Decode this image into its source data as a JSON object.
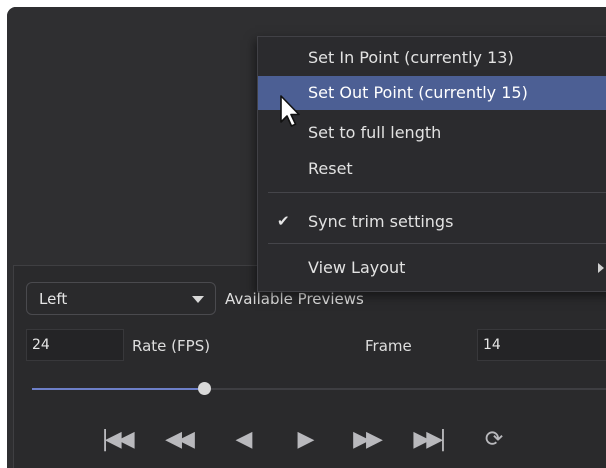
{
  "preview_panel": {
    "view_select": {
      "value": "Left"
    },
    "available_previews_label": "Available Previews",
    "fps_field": {
      "value": "24"
    },
    "rate_label": "Rate (FPS)",
    "frame_label": "Frame",
    "frame_field": {
      "value": "14"
    },
    "scrubber": {
      "position_fraction": 0.3
    },
    "transport_buttons": [
      {
        "icon": "skip-to-start-icon",
        "glyph": "|◀◀"
      },
      {
        "icon": "step-back-icon",
        "glyph": "◀◀"
      },
      {
        "icon": "play-reverse-icon",
        "glyph": "◀"
      },
      {
        "icon": "play-icon",
        "glyph": "▶"
      },
      {
        "icon": "fast-forward-icon",
        "glyph": "▶▶"
      },
      {
        "icon": "skip-to-end-icon",
        "glyph": "▶▶|"
      },
      {
        "icon": "loop-icon",
        "glyph": "⟳"
      }
    ]
  },
  "context_menu": {
    "items": [
      {
        "label": "Set In  Point (currently 13)"
      },
      {
        "label": "Set Out Point (currently 15)",
        "highlighted": true
      },
      {
        "label": "Set to full length"
      },
      {
        "label": "Reset"
      },
      {
        "label": "Sync trim settings",
        "checked": true,
        "check_glyph": "✔"
      },
      {
        "label": "View Layout",
        "submenu": true
      }
    ]
  },
  "colors": {
    "background": "#2f2f31",
    "menu_background": "#2b2b2e",
    "highlight": "#4c5f94",
    "accent_slider": "#6d7fc8"
  }
}
